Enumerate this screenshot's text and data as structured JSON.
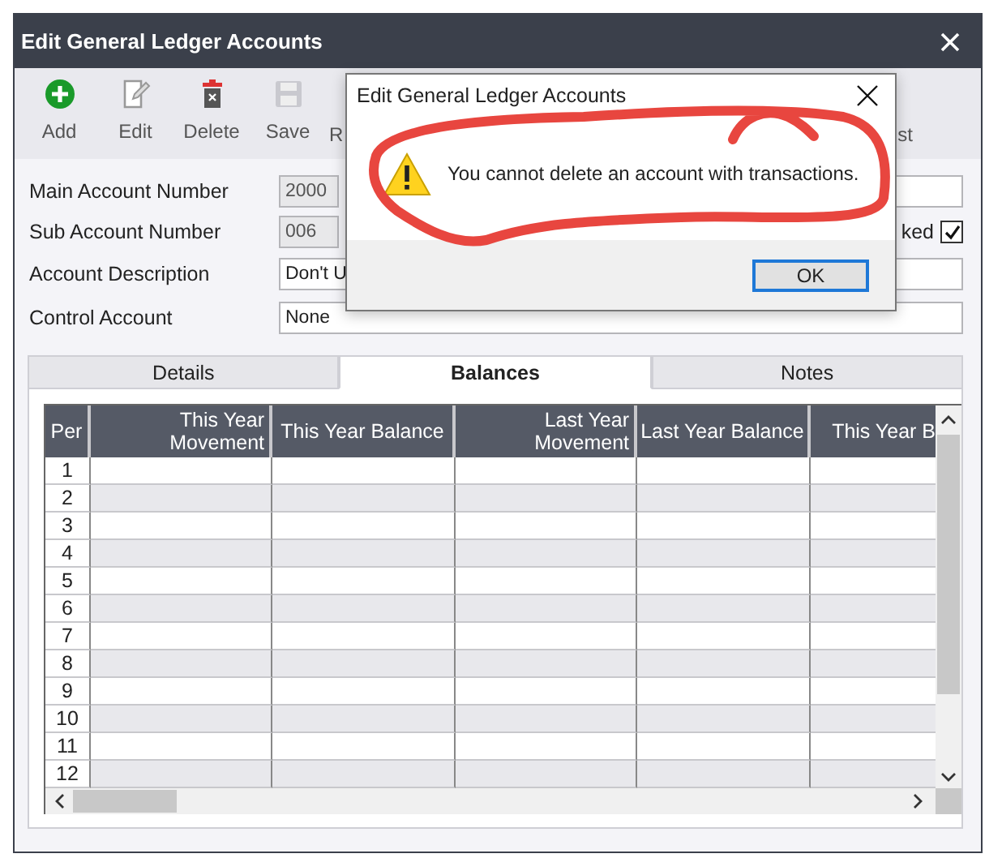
{
  "window": {
    "title": "Edit General Ledger Accounts"
  },
  "toolbar": [
    {
      "label": "Add",
      "kind": "add"
    },
    {
      "label": "Edit",
      "kind": "edit"
    },
    {
      "label": "Delete",
      "kind": "delete"
    },
    {
      "label": "Save",
      "kind": "save"
    },
    {
      "label": "R",
      "kind": "text"
    },
    {
      "label": "st",
      "kind": "text"
    }
  ],
  "form": {
    "main_account_number": {
      "label": "Main Account Number",
      "value": "2000"
    },
    "sub_account_number": {
      "label": "Sub Account Number",
      "value": "006"
    },
    "checkbox": {
      "label": "ked",
      "checked": true
    },
    "account_description": {
      "label": "Account Description",
      "value": "Don't U"
    },
    "control_account": {
      "label": "Control Account",
      "value": "None"
    }
  },
  "tabs": [
    {
      "label": "Details",
      "selected": false
    },
    {
      "label": "Balances",
      "selected": true
    },
    {
      "label": "Notes",
      "selected": false
    }
  ],
  "grid": {
    "columns": [
      {
        "label": "Per",
        "kind": "period"
      },
      {
        "label": "This Year Movement",
        "kind": "wrapped"
      },
      {
        "label": "This Year Balance",
        "kind": "plain"
      },
      {
        "label": "Last Year Movement",
        "kind": "wrapped"
      },
      {
        "label": "Last Year Balance",
        "kind": "plain"
      },
      {
        "label": "This Year B",
        "kind": "plain"
      }
    ],
    "rows": [
      {
        "per": "1"
      },
      {
        "per": "2"
      },
      {
        "per": "3"
      },
      {
        "per": "4"
      },
      {
        "per": "5"
      },
      {
        "per": "6"
      },
      {
        "per": "7"
      },
      {
        "per": "8"
      },
      {
        "per": "9"
      },
      {
        "per": "10"
      },
      {
        "per": "11"
      },
      {
        "per": "12"
      }
    ]
  },
  "dialog": {
    "title": "Edit General Ledger Accounts",
    "message": "You cannot delete an account with transactions.",
    "button": "OK"
  }
}
